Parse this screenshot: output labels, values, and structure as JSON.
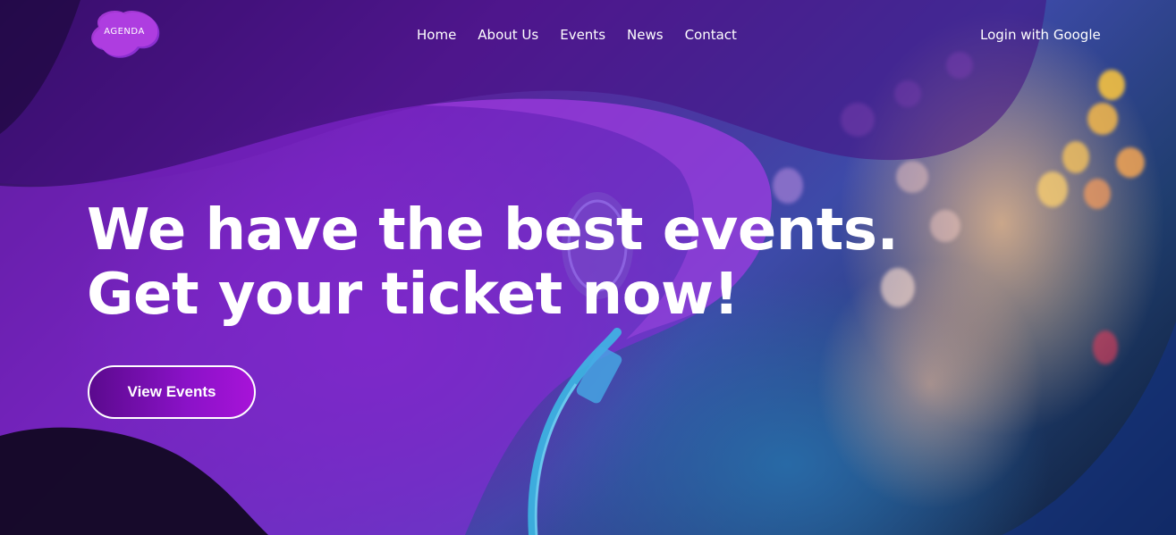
{
  "brand": {
    "logo_text": "AGENDA"
  },
  "nav": {
    "items": [
      {
        "label": "Home"
      },
      {
        "label": "About Us"
      },
      {
        "label": "Events"
      },
      {
        "label": "News"
      },
      {
        "label": "Contact"
      }
    ],
    "login_label": "Login with Google"
  },
  "hero": {
    "headline_line1": "We have the best events.",
    "headline_line2": "Get your ticket now!",
    "cta_label": "View Events"
  },
  "colors": {
    "accent_purple": "#8b12c8",
    "deep_purple": "#5b0a8e",
    "text": "#ffffff"
  }
}
